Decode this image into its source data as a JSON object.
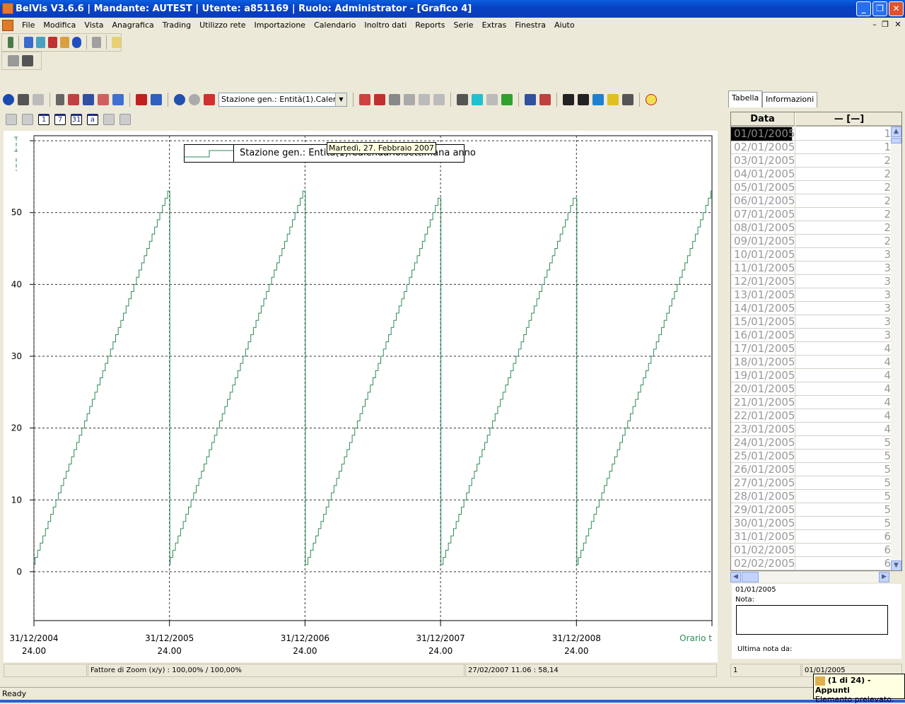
{
  "window": {
    "title": "BelVis V3.6.6  | Mandante: AUTEST | Utente: a851169 | Ruolo: Administrator - [Grafico 4]",
    "minimize": "_",
    "restore": "❐",
    "close": "✕"
  },
  "menu": [
    "File",
    "Modifica",
    "Vista",
    "Anagrafica",
    "Trading",
    "Utilizzo rete",
    "Importazione",
    "Calendario",
    "Inoltro dati",
    "Reports",
    "Serie",
    "Extras",
    "Finestra",
    "Aiuto"
  ],
  "mdi_controls": {
    "minimize": "–",
    "restore": "❐",
    "close": "✕"
  },
  "chart_toolbar": {
    "series_select": "Stazione gen.: Entità(1).Caler"
  },
  "nav_buttons": [
    "1",
    "7",
    "31",
    "a"
  ],
  "tooltip": "Martedì, 27. Febbraio 2007",
  "chart_data": {
    "type": "line",
    "step": true,
    "legend": "top-center",
    "grid": true,
    "xlabel": "Orario t",
    "x_ticks": [
      {
        "date": "31/12/2004",
        "time": "24.00"
      },
      {
        "date": "31/12/2005",
        "time": "24.00"
      },
      {
        "date": "31/12/2006",
        "time": "24.00"
      },
      {
        "date": "31/12/2007",
        "time": "24.00"
      },
      {
        "date": "31/12/2008",
        "time": "24.00"
      }
    ],
    "y_ticks": [
      0,
      10,
      20,
      30,
      40,
      50
    ],
    "ylim": [
      -6.8,
      60.7
    ],
    "xlim": [
      "2004-12-31",
      "2009-12-31"
    ],
    "series": [
      {
        "name": "Stazione gen.: Entità(1).Calendario.settimana anno",
        "color": "#2e8b57",
        "segments": [
          {
            "year": 2005,
            "first_week": 1,
            "last_week": 53
          },
          {
            "year": 2006,
            "first_week": 1,
            "last_week": 53
          },
          {
            "year": 2007,
            "first_week": 1,
            "last_week": 52
          },
          {
            "year": 2008,
            "first_week": 1,
            "last_week": 52
          },
          {
            "year": 2009,
            "first_week": 1,
            "last_week": 53
          }
        ]
      }
    ]
  },
  "chart_status": {
    "zoom": "Fattore di Zoom (x/y) :  100,00% / 100,00%",
    "cursor": "27/02/2007 11.06 : 58,14"
  },
  "right_panel": {
    "tabs": [
      "Tabella",
      "Informazioni"
    ],
    "columns": [
      "Data",
      "— [—]"
    ],
    "rows": [
      [
        "01/01/2005",
        "1"
      ],
      [
        "02/01/2005",
        "1"
      ],
      [
        "03/01/2005",
        "2"
      ],
      [
        "04/01/2005",
        "2"
      ],
      [
        "05/01/2005",
        "2"
      ],
      [
        "06/01/2005",
        "2"
      ],
      [
        "07/01/2005",
        "2"
      ],
      [
        "08/01/2005",
        "2"
      ],
      [
        "09/01/2005",
        "2"
      ],
      [
        "10/01/2005",
        "3"
      ],
      [
        "11/01/2005",
        "3"
      ],
      [
        "12/01/2005",
        "3"
      ],
      [
        "13/01/2005",
        "3"
      ],
      [
        "14/01/2005",
        "3"
      ],
      [
        "15/01/2005",
        "3"
      ],
      [
        "16/01/2005",
        "3"
      ],
      [
        "17/01/2005",
        "4"
      ],
      [
        "18/01/2005",
        "4"
      ],
      [
        "19/01/2005",
        "4"
      ],
      [
        "20/01/2005",
        "4"
      ],
      [
        "21/01/2005",
        "4"
      ],
      [
        "22/01/2005",
        "4"
      ],
      [
        "23/01/2005",
        "4"
      ],
      [
        "24/01/2005",
        "5"
      ],
      [
        "25/01/2005",
        "5"
      ],
      [
        "26/01/2005",
        "5"
      ],
      [
        "27/01/2005",
        "5"
      ],
      [
        "28/01/2005",
        "5"
      ],
      [
        "29/01/2005",
        "5"
      ],
      [
        "30/01/2005",
        "5"
      ],
      [
        "31/01/2005",
        "6"
      ],
      [
        "01/02/2005",
        "6"
      ],
      [
        "02/02/2005",
        "6"
      ]
    ],
    "note_date": "01/01/2005",
    "note_label": "Nota:",
    "last_note_label": "Ultima nota da:",
    "status_left": "1",
    "status_right": "01/01/2005"
  },
  "balloon": {
    "title": "(1 di 24) - Appunti",
    "text": "Elemento prelevato."
  },
  "statusbar": "Ready"
}
